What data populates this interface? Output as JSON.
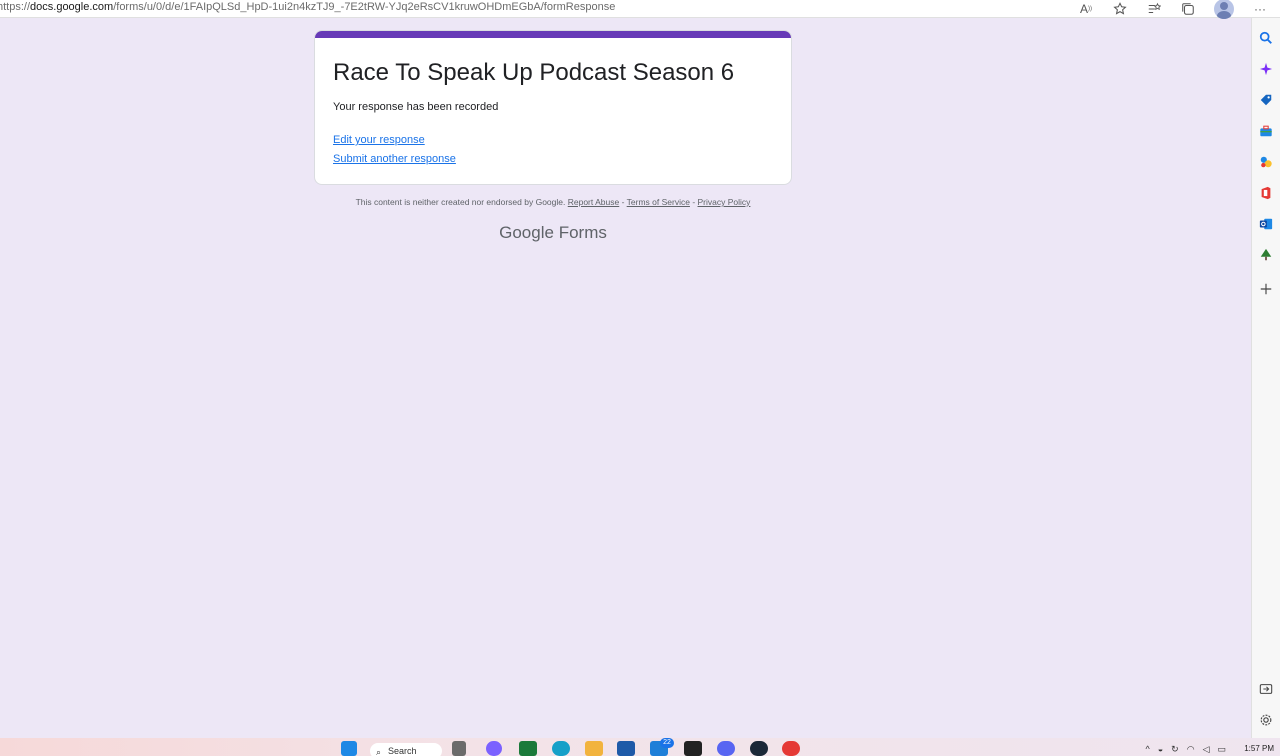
{
  "browser": {
    "url_prefix": "https://",
    "url_host": "docs.google.com",
    "url_path": "/forms/u/0/d/e/1FAIpQLSd_HpD-1ui2n4kzTJ9_-7E2tRW-YJq2eRsCV1kruwOHDmEGbA/formResponse",
    "icons": [
      "read-aloud-icon",
      "add-favorite-icon",
      "favorites-icon",
      "collections-icon",
      "profile-avatar",
      "more-icon"
    ]
  },
  "form": {
    "title": "Race To Speak Up Podcast Season 6",
    "confirmation": "Your response has been recorded",
    "edit_link": "Edit your response",
    "another_link": "Submit another response",
    "accent_color": "#673ab7"
  },
  "footer": {
    "disclaimer": "This content is neither created nor endorsed by Google.",
    "report_abuse": "Report Abuse",
    "terms": "Terms of Service",
    "privacy": "Privacy Policy",
    "brand_google": "Google",
    "brand_forms": "Forms"
  },
  "taskbar": {
    "search_label": "Search",
    "notification_count": "22",
    "clock": "1:57 PM"
  }
}
